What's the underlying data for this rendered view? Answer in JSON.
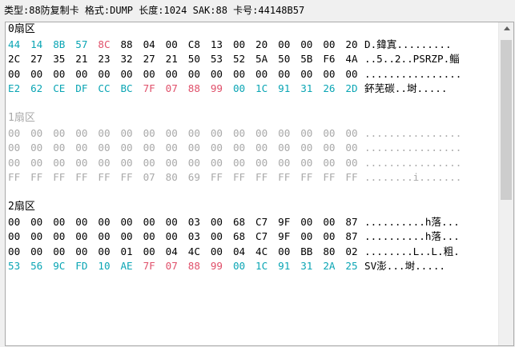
{
  "info": "类型:88防复制卡 格式:DUMP 长度:1024 SAK:88 卡号:44148B57",
  "sectors": [
    {
      "label": "0扇区",
      "style": "normal",
      "rows": [
        {
          "bytes": [
            [
              "44",
              "uid"
            ],
            [
              "14",
              "uid"
            ],
            [
              "8B",
              "uid"
            ],
            [
              "57",
              "uid"
            ],
            [
              "8C",
              "pink"
            ],
            [
              "88",
              "k"
            ],
            [
              "04",
              "k"
            ],
            [
              "00",
              "k"
            ],
            [
              "C8",
              "k"
            ],
            [
              "13",
              "k"
            ],
            [
              "00",
              "k"
            ],
            [
              "20",
              "k"
            ],
            [
              "00",
              "k"
            ],
            [
              "00",
              "k"
            ],
            [
              "00",
              "k"
            ],
            [
              "20",
              "k"
            ]
          ],
          "ascii": "D.鍏寘........."
        },
        {
          "bytes": [
            [
              "2C",
              "k"
            ],
            [
              "27",
              "k"
            ],
            [
              "35",
              "k"
            ],
            [
              "21",
              "k"
            ],
            [
              "23",
              "k"
            ],
            [
              "32",
              "k"
            ],
            [
              "27",
              "k"
            ],
            [
              "21",
              "k"
            ],
            [
              "50",
              "k"
            ],
            [
              "53",
              "k"
            ],
            [
              "52",
              "k"
            ],
            [
              "5A",
              "k"
            ],
            [
              "50",
              "k"
            ],
            [
              "5B",
              "k"
            ],
            [
              "F6",
              "k"
            ],
            [
              "4A",
              "k"
            ]
          ],
          "ascii": "..5..2..PSRZP.鲻"
        },
        {
          "bytes": [
            [
              "00",
              "k"
            ],
            [
              "00",
              "k"
            ],
            [
              "00",
              "k"
            ],
            [
              "00",
              "k"
            ],
            [
              "00",
              "k"
            ],
            [
              "00",
              "k"
            ],
            [
              "00",
              "k"
            ],
            [
              "00",
              "k"
            ],
            [
              "00",
              "k"
            ],
            [
              "00",
              "k"
            ],
            [
              "00",
              "k"
            ],
            [
              "00",
              "k"
            ],
            [
              "00",
              "k"
            ],
            [
              "00",
              "k"
            ],
            [
              "00",
              "k"
            ],
            [
              "00",
              "k"
            ]
          ],
          "ascii": "................"
        },
        {
          "bytes": [
            [
              "E2",
              "uid"
            ],
            [
              "62",
              "uid"
            ],
            [
              "CE",
              "uid"
            ],
            [
              "DF",
              "uid"
            ],
            [
              "CC",
              "uid"
            ],
            [
              "BC",
              "uid"
            ],
            [
              "7F",
              "pink"
            ],
            [
              "07",
              "pink"
            ],
            [
              "88",
              "pink"
            ],
            [
              "99",
              "pink"
            ],
            [
              "00",
              "uid"
            ],
            [
              "1C",
              "uid"
            ],
            [
              "91",
              "uid"
            ],
            [
              "31",
              "uid"
            ],
            [
              "26",
              "uid"
            ],
            [
              "2D",
              "uid"
            ]
          ],
          "ascii": "鈈芜碳..埘....."
        }
      ]
    },
    {
      "label": "1扇区",
      "style": "gray",
      "rows": [
        {
          "bytes": [
            [
              "00",
              "g"
            ],
            [
              "00",
              "g"
            ],
            [
              "00",
              "g"
            ],
            [
              "00",
              "g"
            ],
            [
              "00",
              "g"
            ],
            [
              "00",
              "g"
            ],
            [
              "00",
              "g"
            ],
            [
              "00",
              "g"
            ],
            [
              "00",
              "g"
            ],
            [
              "00",
              "g"
            ],
            [
              "00",
              "g"
            ],
            [
              "00",
              "g"
            ],
            [
              "00",
              "g"
            ],
            [
              "00",
              "g"
            ],
            [
              "00",
              "g"
            ],
            [
              "00",
              "g"
            ]
          ],
          "ascii": "................"
        },
        {
          "bytes": [
            [
              "00",
              "g"
            ],
            [
              "00",
              "g"
            ],
            [
              "00",
              "g"
            ],
            [
              "00",
              "g"
            ],
            [
              "00",
              "g"
            ],
            [
              "00",
              "g"
            ],
            [
              "00",
              "g"
            ],
            [
              "00",
              "g"
            ],
            [
              "00",
              "g"
            ],
            [
              "00",
              "g"
            ],
            [
              "00",
              "g"
            ],
            [
              "00",
              "g"
            ],
            [
              "00",
              "g"
            ],
            [
              "00",
              "g"
            ],
            [
              "00",
              "g"
            ],
            [
              "00",
              "g"
            ]
          ],
          "ascii": "................"
        },
        {
          "bytes": [
            [
              "00",
              "g"
            ],
            [
              "00",
              "g"
            ],
            [
              "00",
              "g"
            ],
            [
              "00",
              "g"
            ],
            [
              "00",
              "g"
            ],
            [
              "00",
              "g"
            ],
            [
              "00",
              "g"
            ],
            [
              "00",
              "g"
            ],
            [
              "00",
              "g"
            ],
            [
              "00",
              "g"
            ],
            [
              "00",
              "g"
            ],
            [
              "00",
              "g"
            ],
            [
              "00",
              "g"
            ],
            [
              "00",
              "g"
            ],
            [
              "00",
              "g"
            ],
            [
              "00",
              "g"
            ]
          ],
          "ascii": "................"
        },
        {
          "bytes": [
            [
              "FF",
              "g"
            ],
            [
              "FF",
              "g"
            ],
            [
              "FF",
              "g"
            ],
            [
              "FF",
              "g"
            ],
            [
              "FF",
              "g"
            ],
            [
              "FF",
              "g"
            ],
            [
              "07",
              "g"
            ],
            [
              "80",
              "g"
            ],
            [
              "69",
              "g"
            ],
            [
              "FF",
              "g"
            ],
            [
              "FF",
              "g"
            ],
            [
              "FF",
              "g"
            ],
            [
              "FF",
              "g"
            ],
            [
              "FF",
              "g"
            ],
            [
              "FF",
              "g"
            ],
            [
              "FF",
              "g"
            ]
          ],
          "ascii": "........i......."
        }
      ]
    },
    {
      "label": "2扇区",
      "style": "normal",
      "rows": [
        {
          "bytes": [
            [
              "00",
              "k"
            ],
            [
              "00",
              "k"
            ],
            [
              "00",
              "k"
            ],
            [
              "00",
              "k"
            ],
            [
              "00",
              "k"
            ],
            [
              "00",
              "k"
            ],
            [
              "00",
              "k"
            ],
            [
              "00",
              "k"
            ],
            [
              "03",
              "k"
            ],
            [
              "00",
              "k"
            ],
            [
              "68",
              "k"
            ],
            [
              "C7",
              "k"
            ],
            [
              "9F",
              "k"
            ],
            [
              "00",
              "k"
            ],
            [
              "00",
              "k"
            ],
            [
              "87",
              "k"
            ]
          ],
          "ascii": "..........h落..."
        },
        {
          "bytes": [
            [
              "00",
              "k"
            ],
            [
              "00",
              "k"
            ],
            [
              "00",
              "k"
            ],
            [
              "00",
              "k"
            ],
            [
              "00",
              "k"
            ],
            [
              "00",
              "k"
            ],
            [
              "00",
              "k"
            ],
            [
              "00",
              "k"
            ],
            [
              "03",
              "k"
            ],
            [
              "00",
              "k"
            ],
            [
              "68",
              "k"
            ],
            [
              "C7",
              "k"
            ],
            [
              "9F",
              "k"
            ],
            [
              "00",
              "k"
            ],
            [
              "00",
              "k"
            ],
            [
              "87",
              "k"
            ]
          ],
          "ascii": "..........h落..."
        },
        {
          "bytes": [
            [
              "00",
              "k"
            ],
            [
              "00",
              "k"
            ],
            [
              "00",
              "k"
            ],
            [
              "00",
              "k"
            ],
            [
              "00",
              "k"
            ],
            [
              "01",
              "k"
            ],
            [
              "00",
              "k"
            ],
            [
              "04",
              "k"
            ],
            [
              "4C",
              "k"
            ],
            [
              "00",
              "k"
            ],
            [
              "04",
              "k"
            ],
            [
              "4C",
              "k"
            ],
            [
              "00",
              "k"
            ],
            [
              "BB",
              "k"
            ],
            [
              "80",
              "k"
            ],
            [
              "02",
              "k"
            ]
          ],
          "ascii": "........L..L.粗."
        },
        {
          "bytes": [
            [
              "53",
              "uid"
            ],
            [
              "56",
              "uid"
            ],
            [
              "9C",
              "uid"
            ],
            [
              "FD",
              "uid"
            ],
            [
              "10",
              "uid"
            ],
            [
              "AE",
              "uid"
            ],
            [
              "7F",
              "pink"
            ],
            [
              "07",
              "pink"
            ],
            [
              "88",
              "pink"
            ],
            [
              "99",
              "pink"
            ],
            [
              "00",
              "uid"
            ],
            [
              "1C",
              "uid"
            ],
            [
              "91",
              "uid"
            ],
            [
              "31",
              "uid"
            ],
            [
              "2A",
              "uid"
            ],
            [
              "25",
              "uid"
            ]
          ],
          "ascii": "SV澎...埘....."
        }
      ]
    }
  ]
}
